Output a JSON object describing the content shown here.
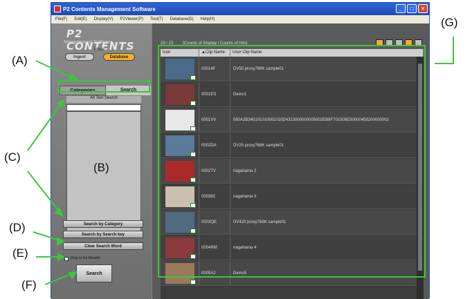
{
  "window": {
    "title": "P2 Contents Management Software",
    "menu": [
      "File(F)",
      "Edit(E)",
      "Display(V)",
      "P2Viewer(P)",
      "Tool(T)",
      "Database(D)",
      "Help(H)"
    ]
  },
  "left": {
    "logo": "P2 CONTENTS",
    "logo_sub": "Management Software",
    "mode_label": "Mode",
    "mode_ingest": "Ingest",
    "mode_database": "Database",
    "tab_categories": "Categories",
    "tab_search": "Search",
    "all_text_search": "All Text Search",
    "search_by_category": "Search by Category",
    "search_by_key": "Search by Search key",
    "clear_search": "Clear Search Word",
    "checkbox_label": "Drop in the Results",
    "search_button": "Search"
  },
  "right": {
    "count": "23 / 23",
    "count_desc": "[Counts of Display / Counts of Hits]",
    "col_icon": "Icon",
    "col_clip": "▲Clip Name",
    "col_user": "User Clip Name",
    "rows": [
      {
        "clip": "00014F",
        "user": "DV50 proxy768K sample01",
        "color": "#4a6a8a"
      },
      {
        "clip": "0001ES",
        "user": "Demo1",
        "color": "#7a3a3a"
      },
      {
        "clip": "0001VV",
        "user": "060A2B340101010501010D4313000000005602EB8F701505E50000458200000002",
        "color": "#e8e8e8"
      },
      {
        "clip": "0002DA",
        "user": "DV25 proxy768K sample01",
        "color": "#5a7a9a"
      },
      {
        "clip": "0002TV",
        "user": "nagahama 2",
        "color": "#aa2a2a"
      },
      {
        "clip": "000382",
        "user": "nagahama 3",
        "color": "#c9c0b0"
      },
      {
        "clip": "0003QE",
        "user": "DV420 proxy768K sample01",
        "color": "#506a80"
      },
      {
        "clip": "0004RM",
        "user": "nagahama 4",
        "color": "#8a3a3a"
      },
      {
        "clip": "0005A2",
        "user": "Demo5",
        "color": "#9a7a5a"
      }
    ]
  },
  "callouts": {
    "A": "(A)",
    "B": "(B)",
    "C": "(C)",
    "D": "(D)",
    "E": "(E)",
    "F": "(F)",
    "G": "(G)"
  },
  "colors": {
    "accent": "#f0b030",
    "highlight": "#3cc63c",
    "titlebar": "#2e63d6"
  }
}
